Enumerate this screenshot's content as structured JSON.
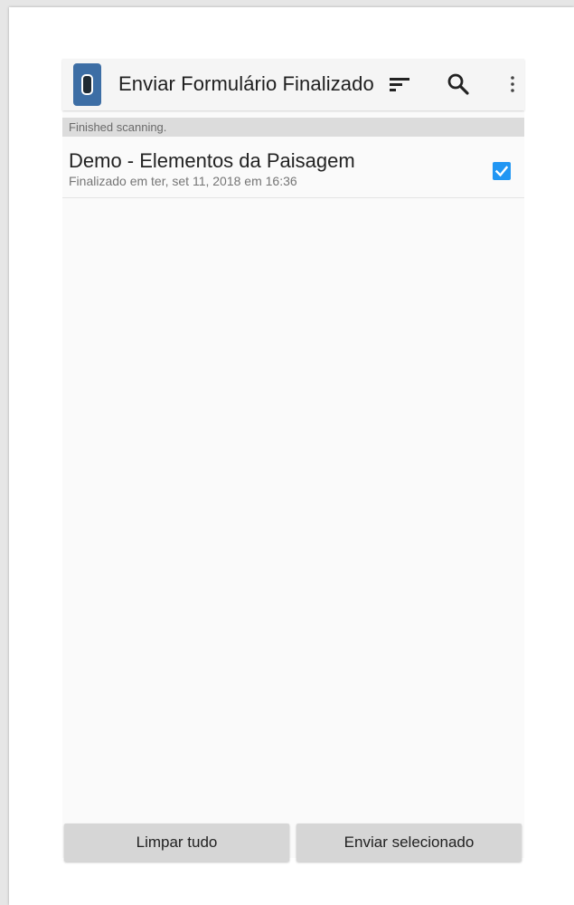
{
  "toolbar": {
    "title": "Enviar Formulário Finalizado",
    "icons": [
      "app-logo-icon",
      "sort-icon",
      "search-icon",
      "overflow-menu-icon"
    ]
  },
  "status": {
    "text": "Finished scanning."
  },
  "forms": [
    {
      "title": "Demo - Elementos da Paisagem",
      "subtitle": "Finalizado em ter, set 11, 2018 em 16:36",
      "checked": true
    }
  ],
  "actions": {
    "clear_all_label": "Limpar tudo",
    "send_selected_label": "Enviar selecionado"
  },
  "colors": {
    "accent": "#2196f3",
    "app_icon": "#3d6ea5",
    "toolbar_bg": "#f5f5f5",
    "status_bg": "#dcdcdc",
    "button_bg": "#d6d6d6"
  }
}
